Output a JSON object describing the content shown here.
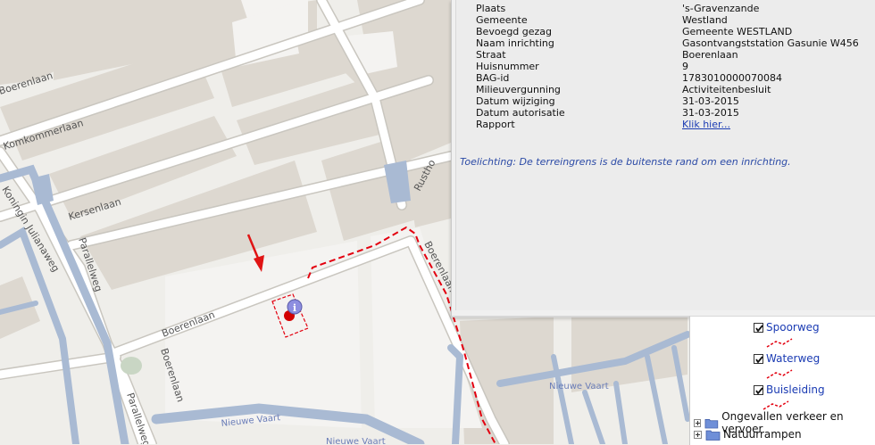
{
  "map": {
    "streets": [
      "Boerenlaan",
      "Komkommerlaan",
      "Kersenlaan",
      "Koningin Julianaweg",
      "Parallelweg",
      "Boerenlaan",
      "Boerenlaan",
      "Rustho",
      "Parallelweg",
      "Boerenlaan"
    ],
    "water_labels": [
      "Nieuwe Vaart",
      "Nieuwe Vaart",
      "Nieuwe Vaart"
    ],
    "marker_icon": "info-icon",
    "pointer_icon": "red-arrow-icon",
    "boundary_color": "#e3000f"
  },
  "popup": {
    "rows": [
      {
        "key": "Plaats",
        "value": "'s-Gravenzande"
      },
      {
        "key": "Gemeente",
        "value": "Westland"
      },
      {
        "key": "Bevoegd gezag",
        "value": "Gemeente WESTLAND"
      },
      {
        "key": "Naam inrichting",
        "value": "Gasontvangststation Gasunie W456"
      },
      {
        "key": "Straat",
        "value": "Boerenlaan"
      },
      {
        "key": "Huisnummer",
        "value": "9"
      },
      {
        "key": "BAG-id",
        "value": "1783010000070084"
      },
      {
        "key": "Milieuvergunning",
        "value": "Activiteitenbesluit"
      },
      {
        "key": "Datum wijziging",
        "value": "31-03-2015"
      },
      {
        "key": "Datum autorisatie",
        "value": "31-03-2015"
      },
      {
        "key": "Rapport",
        "value": "Klik hier..."
      }
    ],
    "note": "Toelichting: De terreingrens is de buitenste rand om een inrichting."
  },
  "legend": {
    "layers": [
      {
        "label": "Spoorweg",
        "checked": true
      },
      {
        "label": "Waterweg",
        "checked": true
      },
      {
        "label": "Buisleiding",
        "checked": true
      }
    ],
    "groups": [
      {
        "label": "Ongevallen verkeer en vervoer"
      },
      {
        "label": "Natuurrampen"
      }
    ]
  }
}
